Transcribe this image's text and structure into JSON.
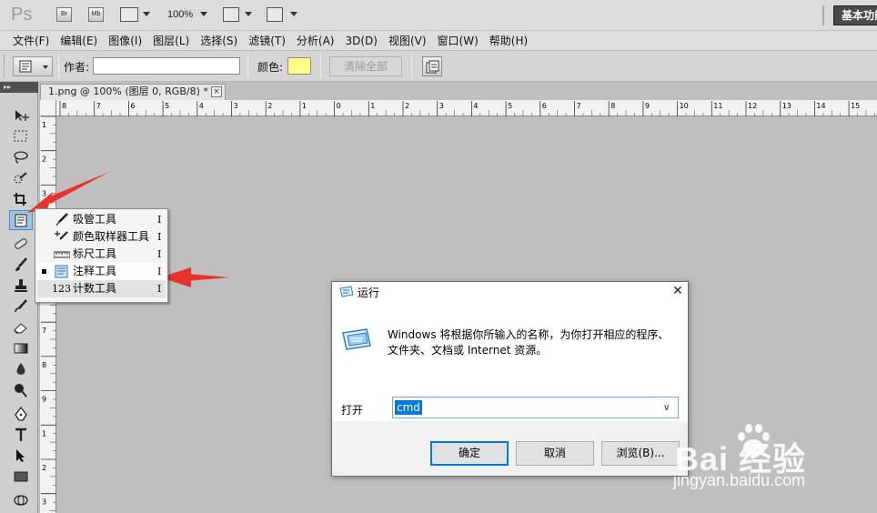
{
  "app": {
    "logo": "Ps",
    "bridge_btn": "Br",
    "minibridge_btn": "Mb",
    "zoom": "100%",
    "workspace": "基本功能"
  },
  "menu": [
    "文件(F)",
    "编辑(E)",
    "图像(I)",
    "图层(L)",
    "选择(S)",
    "滤镜(T)",
    "分析(A)",
    "3D(D)",
    "视图(V)",
    "窗口(W)",
    "帮助(H)"
  ],
  "options": {
    "author_label": "作者:",
    "author_value": "",
    "color_label": "颜色:",
    "note_color": "#ffff88",
    "clear_all": "清除全部"
  },
  "document": {
    "tab_title": "1.png @ 100% (图层 0, RGB/8) *",
    "close": "×",
    "ruler_top": [
      "8",
      "7",
      "6",
      "5",
      "4",
      "3",
      "2",
      "1",
      "0",
      "1",
      "2",
      "3",
      "4",
      "5",
      "6",
      "7",
      "8",
      "9",
      "10",
      "11",
      "12",
      "13",
      "14",
      "15"
    ],
    "ruler_left": [
      "1",
      "2",
      "3",
      "4",
      "5",
      "6",
      "7",
      "8",
      "9",
      "1",
      "2",
      "3"
    ]
  },
  "flyout": {
    "items": [
      {
        "label": "吸管工具",
        "key": "I",
        "icon": "eyedropper-icon"
      },
      {
        "label": "颜色取样器工具",
        "key": "I",
        "icon": "color-sampler-icon"
      },
      {
        "label": "标尺工具",
        "key": "I",
        "icon": "ruler-icon"
      },
      {
        "label": "注释工具",
        "key": "I",
        "icon": "note-icon"
      },
      {
        "label": "计数工具",
        "key": "I",
        "icon": "count-icon"
      }
    ],
    "count_glyph": "123"
  },
  "dialog": {
    "title": "运行",
    "close": "✕",
    "description": "Windows 将根据你所输入的名称，为你打开相应的程序、文件夹、文档或 Internet 资源。",
    "open_label": "打开",
    "open_value": "cmd",
    "ok": "确定",
    "cancel": "取消",
    "browse": "浏览(B)..."
  },
  "watermark": {
    "brand": "Bai  经验",
    "site": "jingyan.baidu.com"
  },
  "colors": {
    "arrow": "#e8322e",
    "selection": "#0078d7"
  }
}
